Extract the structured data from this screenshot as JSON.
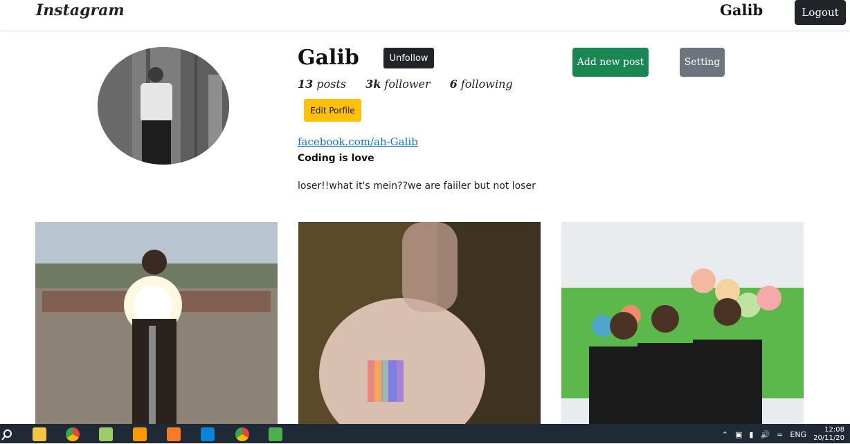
{
  "navbar": {
    "brand": "Instagram",
    "username": "Galib",
    "logout_label": "Logout"
  },
  "profile": {
    "name": "Galib",
    "unfollow_label": "Unfollow",
    "add_post_label": "Add new post",
    "setting_label": "Setting",
    "stats": {
      "posts_count": "13",
      "posts_label": "posts",
      "follower_count": "3k",
      "follower_label": "follower",
      "following_count": "6",
      "following_label": "following"
    },
    "edit_label": "Edit Porfile",
    "link": "facebook.com/ah-Galib",
    "tagline": "Coding is love",
    "bio": "loser!!what it's mein??we are faiiler but not loser"
  },
  "taskbar": {
    "language": "ENG",
    "time": "12:08",
    "date": "20/11/20"
  },
  "colors": {
    "dark": "#212529",
    "success": "#198754",
    "secondary": "#6c757d",
    "warning": "#ffc107",
    "link": "#0d6efd"
  }
}
